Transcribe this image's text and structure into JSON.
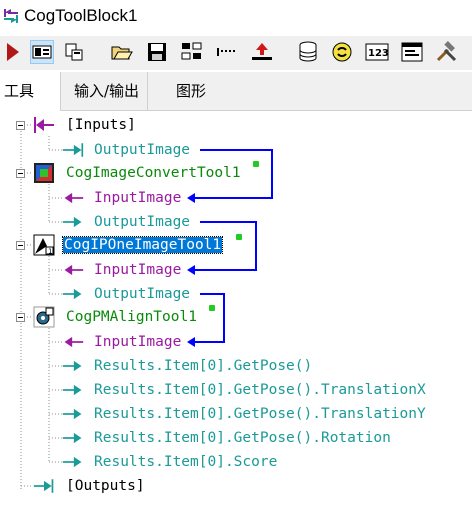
{
  "window": {
    "title": "CogToolBlock1"
  },
  "toolbar": {
    "buttons": [
      "run-icon",
      "show-display-icon",
      "show-edit-icon",
      "open-folder-icon",
      "save-icon",
      "copy-terminal-icon",
      "dotted-line-icon",
      "add-terminal-icon",
      "database-icon",
      "refresh-icon",
      "numeric-123-icon",
      "form-icon",
      "tools-icon"
    ]
  },
  "tabs": [
    "工具",
    "输入/输出",
    "图形"
  ],
  "tree": {
    "inputs": "[Inputs]",
    "inputs_output_image": "OutputImage",
    "tool1": {
      "name": "CogImageConvertTool1",
      "input": "InputImage",
      "output": "OutputImage"
    },
    "tool2": {
      "name": "CogIPOneImageTool1",
      "input": "InputImage",
      "output": "OutputImage"
    },
    "tool3": {
      "name": "CogPMAlignTool1",
      "input": "InputImage",
      "results": [
        "Results.Item[0].GetPose()",
        "Results.Item[0].GetPose().TranslationX",
        "Results.Item[0].GetPose().TranslationY",
        "Results.Item[0].GetPose().Rotation",
        "Results.Item[0].Score"
      ]
    },
    "outputs": "[Outputs]"
  },
  "colors": {
    "link": "#0000ff",
    "teal": "#1a9a98",
    "purple": "#9a1aa0",
    "green": "#0a8a0a",
    "selection": "#0078d7"
  }
}
